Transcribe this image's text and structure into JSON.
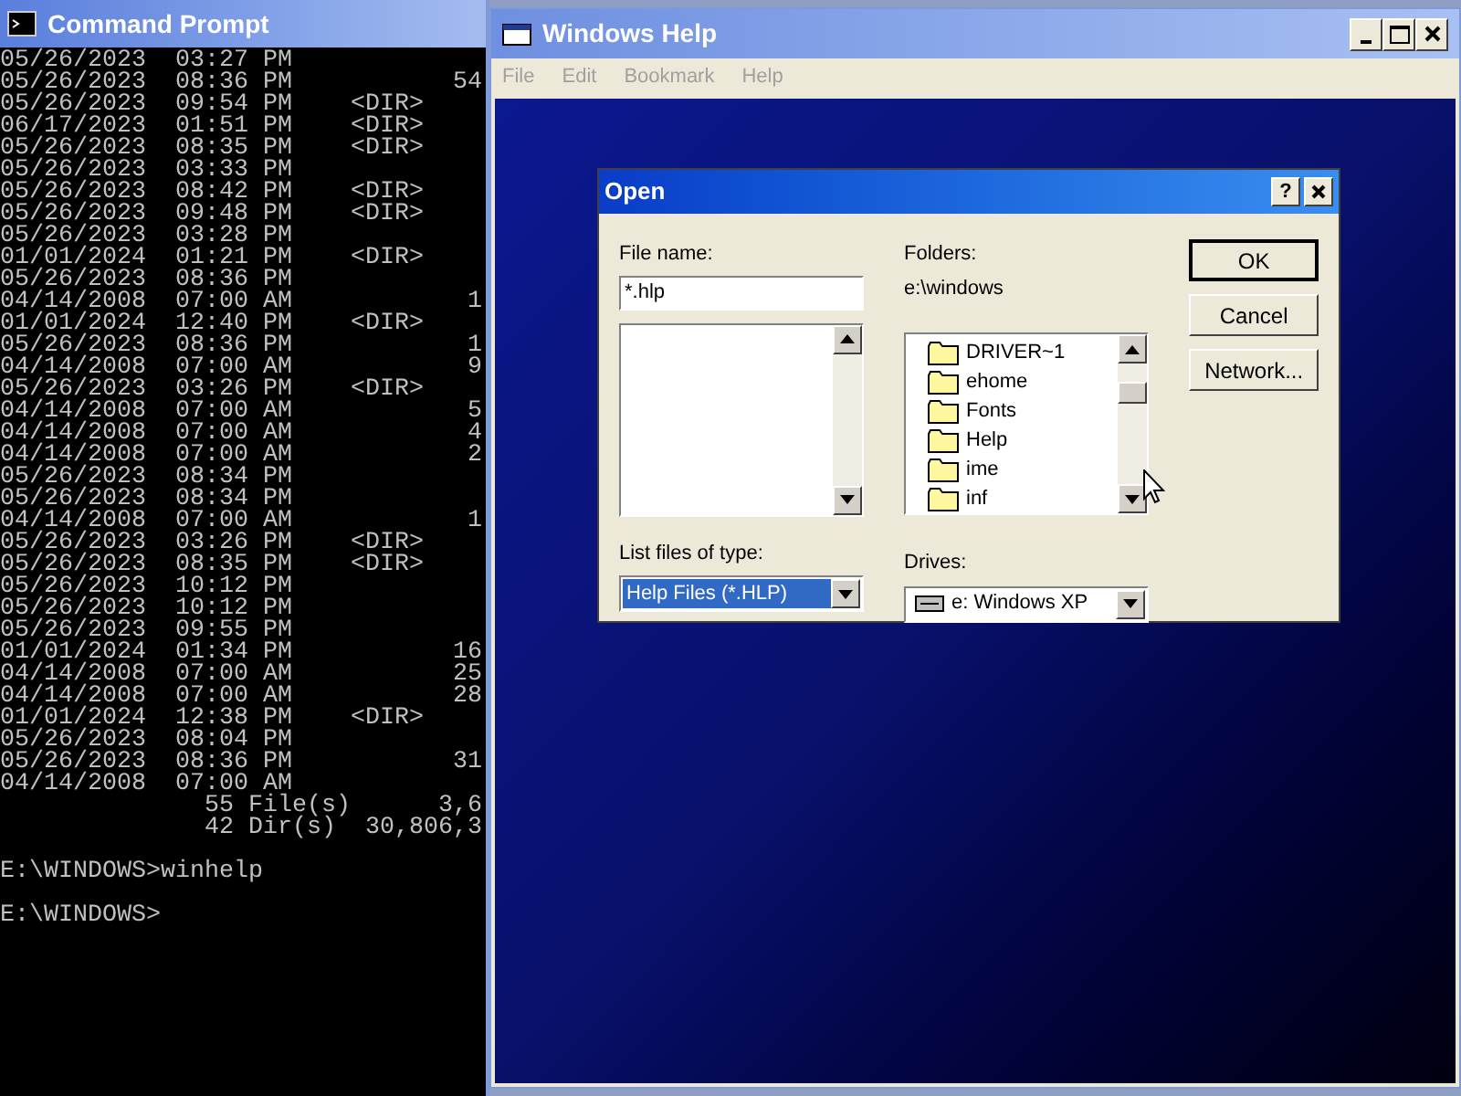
{
  "console": {
    "title": "Command Prompt",
    "lines": [
      "05/26/2023  03:27 PM",
      "05/26/2023  08:36 PM           54",
      "05/26/2023  09:54 PM    <DIR>",
      "06/17/2023  01:51 PM    <DIR>",
      "05/26/2023  08:35 PM    <DIR>",
      "05/26/2023  03:33 PM",
      "05/26/2023  08:42 PM    <DIR>",
      "05/26/2023  09:48 PM    <DIR>",
      "05/26/2023  03:28 PM",
      "01/01/2024  01:21 PM    <DIR>",
      "05/26/2023  08:36 PM",
      "04/14/2008  07:00 AM            1",
      "01/01/2024  12:40 PM    <DIR>",
      "05/26/2023  08:36 PM            1",
      "04/14/2008  07:00 AM            9",
      "05/26/2023  03:26 PM    <DIR>",
      "04/14/2008  07:00 AM            5",
      "04/14/2008  07:00 AM            4",
      "04/14/2008  07:00 AM            2",
      "05/26/2023  08:34 PM",
      "05/26/2023  08:34 PM",
      "04/14/2008  07:00 AM            1",
      "05/26/2023  03:26 PM    <DIR>",
      "05/26/2023  08:35 PM    <DIR>",
      "05/26/2023  10:12 PM",
      "05/26/2023  10:12 PM",
      "05/26/2023  09:55 PM",
      "01/01/2024  01:34 PM           16",
      "04/14/2008  07:00 AM           25",
      "04/14/2008  07:00 AM           28",
      "01/01/2024  12:38 PM    <DIR>",
      "05/26/2023  08:04 PM",
      "05/26/2023  08:36 PM           31",
      "04/14/2008  07:00 AM",
      "              55 File(s)      3,6",
      "              42 Dir(s)  30,806,3"
    ],
    "prompts": [
      "E:\\WINDOWS>winhelp",
      "E:\\WINDOWS>"
    ]
  },
  "help_window": {
    "title": "Windows Help",
    "menu": [
      {
        "label": "File",
        "disabled": true
      },
      {
        "label": "Edit",
        "disabled": true
      },
      {
        "label": "Bookmark",
        "disabled": true
      },
      {
        "label": "Help",
        "disabled": true
      }
    ]
  },
  "open_dialog": {
    "title": "Open",
    "help_button": "?",
    "file_name": {
      "label": "File name:",
      "value": "*.hlp"
    },
    "folders": {
      "label": "Folders:",
      "path": "e:\\windows",
      "items": [
        {
          "name": "DRIVER~1"
        },
        {
          "name": "ehome"
        },
        {
          "name": "Fonts"
        },
        {
          "name": "Help"
        },
        {
          "name": "ime"
        },
        {
          "name": "inf"
        }
      ]
    },
    "file_type": {
      "label": "List files of type:",
      "value": "Help Files (*.HLP)",
      "selected": true
    },
    "drives": {
      "label": "Drives:",
      "value": "e: Windows XP"
    },
    "buttons": [
      {
        "label": "OK",
        "default": true
      },
      {
        "label": "Cancel",
        "default": false
      },
      {
        "label": "Network...",
        "default": false
      }
    ]
  }
}
